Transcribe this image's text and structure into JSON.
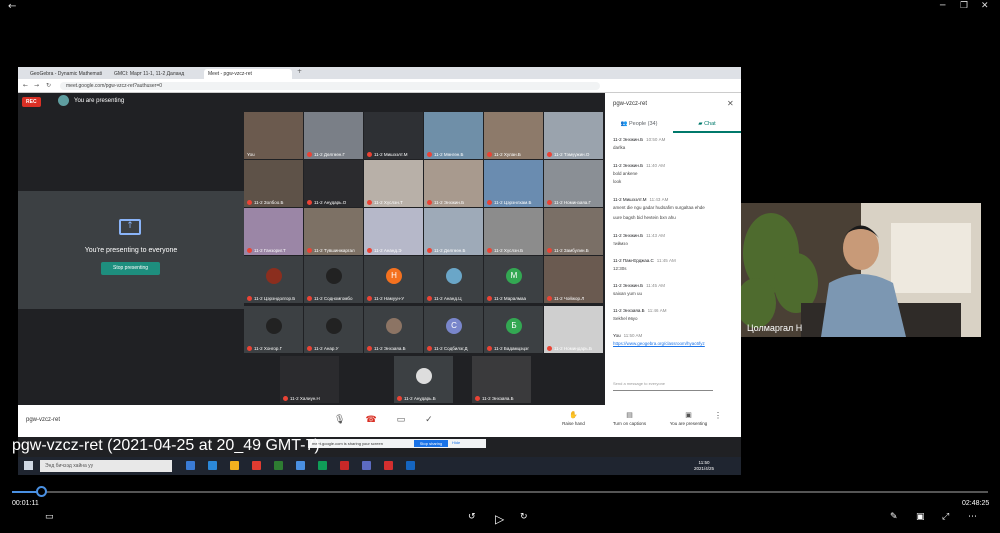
{
  "player": {
    "title": "pgw-vzcz-ret (2021-04-25 at 20_49 GMT-7)",
    "current_time": "00:01:11",
    "duration": "02:48:25",
    "progress_fraction": 0.03
  },
  "browser": {
    "tabs": [
      "GeoGebra - Dynamic Mathemati",
      "GMCI: Март 11-1, 11-2 Даланд",
      "Meet - pgw-vzcz-ret"
    ],
    "url": "meet.google.com/pgw-vzcz-ret?authuser=0"
  },
  "meet": {
    "rec_label": "REC",
    "presenting_label": "You are presenting",
    "present_panel_text": "You're presenting to everyone",
    "stop_presenting": "Stop presenting",
    "meeting_code": "pgw-vzcz-ret",
    "controls": {
      "raise_hand": "Raise hand",
      "captions": "Turn on captions",
      "you_presenting": "You are presenting"
    },
    "share_bar": {
      "text": "meet.google.com is sharing your screen",
      "stop": "Stop sharing",
      "hide": "Hide"
    },
    "participants": [
      {
        "name": "You",
        "bg": "#6b5a4e"
      },
      {
        "name": "11-2 Дөлгөөн.Г",
        "bg": "#7a7f87"
      },
      {
        "name": "11-2 Мишээлт.М",
        "bg": "#2e3034"
      },
      {
        "name": "11-2 Мөнгөн.Б",
        "bg": "#6f8fa8"
      },
      {
        "name": "11-2 Хулан.Б",
        "bg": "#8d7a6a"
      },
      {
        "name": "11-2 Тэмүүжин.О",
        "bg": "#9aa3ad"
      },
      {
        "name": "11-2 Золбоо.Б",
        "bg": "#5e5248"
      },
      {
        "name": "11-2 Анударь.О",
        "bg": "#2b2b2e"
      },
      {
        "name": "11-2 Хүслэн.Т",
        "bg": "#b8b0a8"
      },
      {
        "name": "11-2 Энхжин.Б",
        "bg": "#a89a8e"
      },
      {
        "name": "11-2 Цэрэнлхам.Б",
        "bg": "#6a8cb0"
      },
      {
        "name": "11-2 Номинзаяа.Г",
        "bg": "#8a8f95"
      },
      {
        "name": "11-2 Ганзориг.Т",
        "bg": "#9b86a6"
      },
      {
        "name": "11-2 Түвшинжаргал",
        "bg": "#7d7165"
      },
      {
        "name": "11-2 Ананд.Э",
        "bg": "#b6b8c9"
      },
      {
        "name": "11-2 Дөлгөөн.Б",
        "bg": "#9eaab8"
      },
      {
        "name": "11-2 Хүслэн.Б",
        "bg": "#8c8c8c"
      },
      {
        "name": "11-2 Замбулин.Б",
        "bg": "#7a6f66"
      },
      {
        "name": "11-2 Цэрэндолгор.Б",
        "bg": "#3c4043",
        "initial": "",
        "ibg": "#8b2e1e"
      },
      {
        "name": "11-2 Содномгомбо",
        "bg": "#3c4043",
        "initial": "",
        "ibg": "#222"
      },
      {
        "name": "11-2 Намуун-У",
        "bg": "#3c4043",
        "initial": "Н",
        "ibg": "#f4711f"
      },
      {
        "name": "11-2 Ананд.Ц",
        "bg": "#3c4043",
        "initial": "",
        "ibg": "#6aa6c8"
      },
      {
        "name": "11-2 Маралмаа",
        "bg": "#3c4043",
        "initial": "М",
        "ibg": "#33a852"
      },
      {
        "name": "11-2 Чойжор.Л",
        "bg": "#6a5a50"
      },
      {
        "name": "11-2 Хонгор.Г",
        "bg": "#3c4043",
        "initial": "",
        "ibg": "#222"
      },
      {
        "name": "11-2 Анар.У",
        "bg": "#3c4043",
        "initial": "",
        "ibg": "#222"
      },
      {
        "name": "11-2 Энхзаяа.Б",
        "bg": "#3c4043",
        "initial": "",
        "ibg": "#8c7464"
      },
      {
        "name": "11-2 Содбилэг.Д",
        "bg": "#3c4043",
        "initial": "С",
        "ibg": "#7986cb"
      },
      {
        "name": "11-2 Бадамцэцэг",
        "bg": "#3c4043",
        "initial": "Б",
        "ibg": "#33a852"
      },
      {
        "name": "11-2 Номиндарь.Б",
        "bg": "#cfcfcf"
      },
      {
        "name": "11-2 Халиун.Н",
        "bg": "#2b2b2e"
      },
      {
        "name": "11-2 Анударь.Б",
        "bg": "#3c4043",
        "initial": "",
        "ibg": "#ddd"
      },
      {
        "name": "11-2 Энхзаяа.Б",
        "bg": "#3a3a3c"
      }
    ],
    "extra_initial": "З"
  },
  "chat": {
    "meeting_code": "pgw-vzcz-ret",
    "people_tab": "People (34)",
    "chat_tab": "Chat",
    "messages": [
      {
        "who": "11-2 Энхжин.Б",
        "time": "10:50 AM",
        "text": "darlka"
      },
      {
        "who": "11-2 Энхжин.Б",
        "time": "11:40 AM",
        "text": "bold ankene"
      },
      {
        "who": "",
        "time": "",
        "text": "look"
      },
      {
        "who": "11-2 Мишээлт.М",
        "time": "11:43 AM",
        "text": "ament die ngu gadar hudsafim surgaltaa ehde"
      },
      {
        "who": "",
        "time": "",
        "text": "uure bagsh bid hevtein bxn ahu"
      },
      {
        "who": "11-2 Энхжин.Б",
        "time": "11:43 AM",
        "text": "тиймээ"
      },
      {
        "who": "11-2 Пам-Ерджаа.С",
        "time": "11:45 AM",
        "text": "12:30s"
      },
      {
        "who": "11-2 Энхжин.Б",
        "time": "11:45 AM",
        "text": "saiхan yum uu"
      },
      {
        "who": "11-2 Энхзаяа.Б",
        "time": "11:46 AM",
        "text": "Sekhel ёвуо"
      },
      {
        "who": "You",
        "time": "11:50 AM",
        "text": "https://www.geogebra.org/classroom/hyac6fyz"
      }
    ],
    "input_placeholder": "Send a message to everyone"
  },
  "webcam": {
    "name": "Цолмаргал Н"
  },
  "taskbar": {
    "search_placeholder": "Энд бичээд хайна уу",
    "clock_time": "11:50",
    "clock_date": "2021/4/25",
    "app_colors": [
      "#3a7bd5",
      "#2b88d8",
      "#f2b01e",
      "#e03c31",
      "#2e7d32",
      "#4a90e2",
      "#0f9d58",
      "#c62828",
      "#5c6bc0",
      "#d32f2f",
      "#1565c0"
    ]
  }
}
